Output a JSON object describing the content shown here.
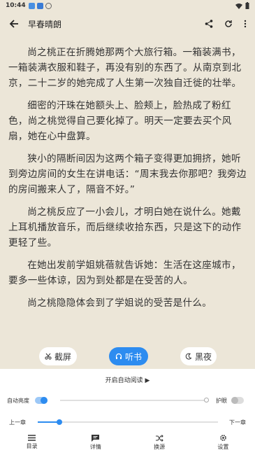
{
  "status": {
    "time": "10:44"
  },
  "header": {
    "title": "早春晴朗"
  },
  "paragraphs": [
    "尚之桃正在折腾她那两个大旅行箱。一箱装满书，一箱装满衣服和鞋子，再没有别的东西了。从南京到北京，二十二岁的她完成了人生第一次独自迁徙的壮举。",
    "细密的汗珠在她额头上、脸颊上，脸热成了粉红色，尚之桃觉得自己要化掉了。明天一定要去买个风扇，她在心中盘算。",
    "狭小的隔断间因为这两个箱子变得更加拥挤，她听到旁边房间的女生在讲电话：“周末我去你那吧？我旁边的房间搬来人了，隔音不好。”",
    "尚之桃反应了一小会儿，才明白她在说什么。她戴上耳机播放音乐，而后继续收拾东西，只是这下的动作更轻了些。",
    "在她出发前学姐姚蓓就告诉她：生活在这座城市，要多一些体谅，因为到处都是在受苦的人。",
    "尚之桃隐隐体会到了学姐说的受苦是什么。"
  ],
  "floating": {
    "screenshot": "截屏",
    "listen": "听书",
    "night": "黑夜"
  },
  "panel": {
    "auto_read": "开启自动阅读 ▶",
    "brightness_label": "自动亮度",
    "eye_care_label": "护眼",
    "brightness_value": 0.0,
    "prev_chapter": "上一章",
    "next_chapter": "下一章",
    "chapter_progress": 0.12
  },
  "nav": [
    {
      "label": "目录",
      "icon": "menu-icon"
    },
    {
      "label": "详情",
      "icon": "comment-icon"
    },
    {
      "label": "换源",
      "icon": "shuffle-icon"
    },
    {
      "label": "设置",
      "icon": "gear-icon"
    }
  ],
  "colors": {
    "accent": "#2d8cf0",
    "paper": "#ece6d8"
  }
}
